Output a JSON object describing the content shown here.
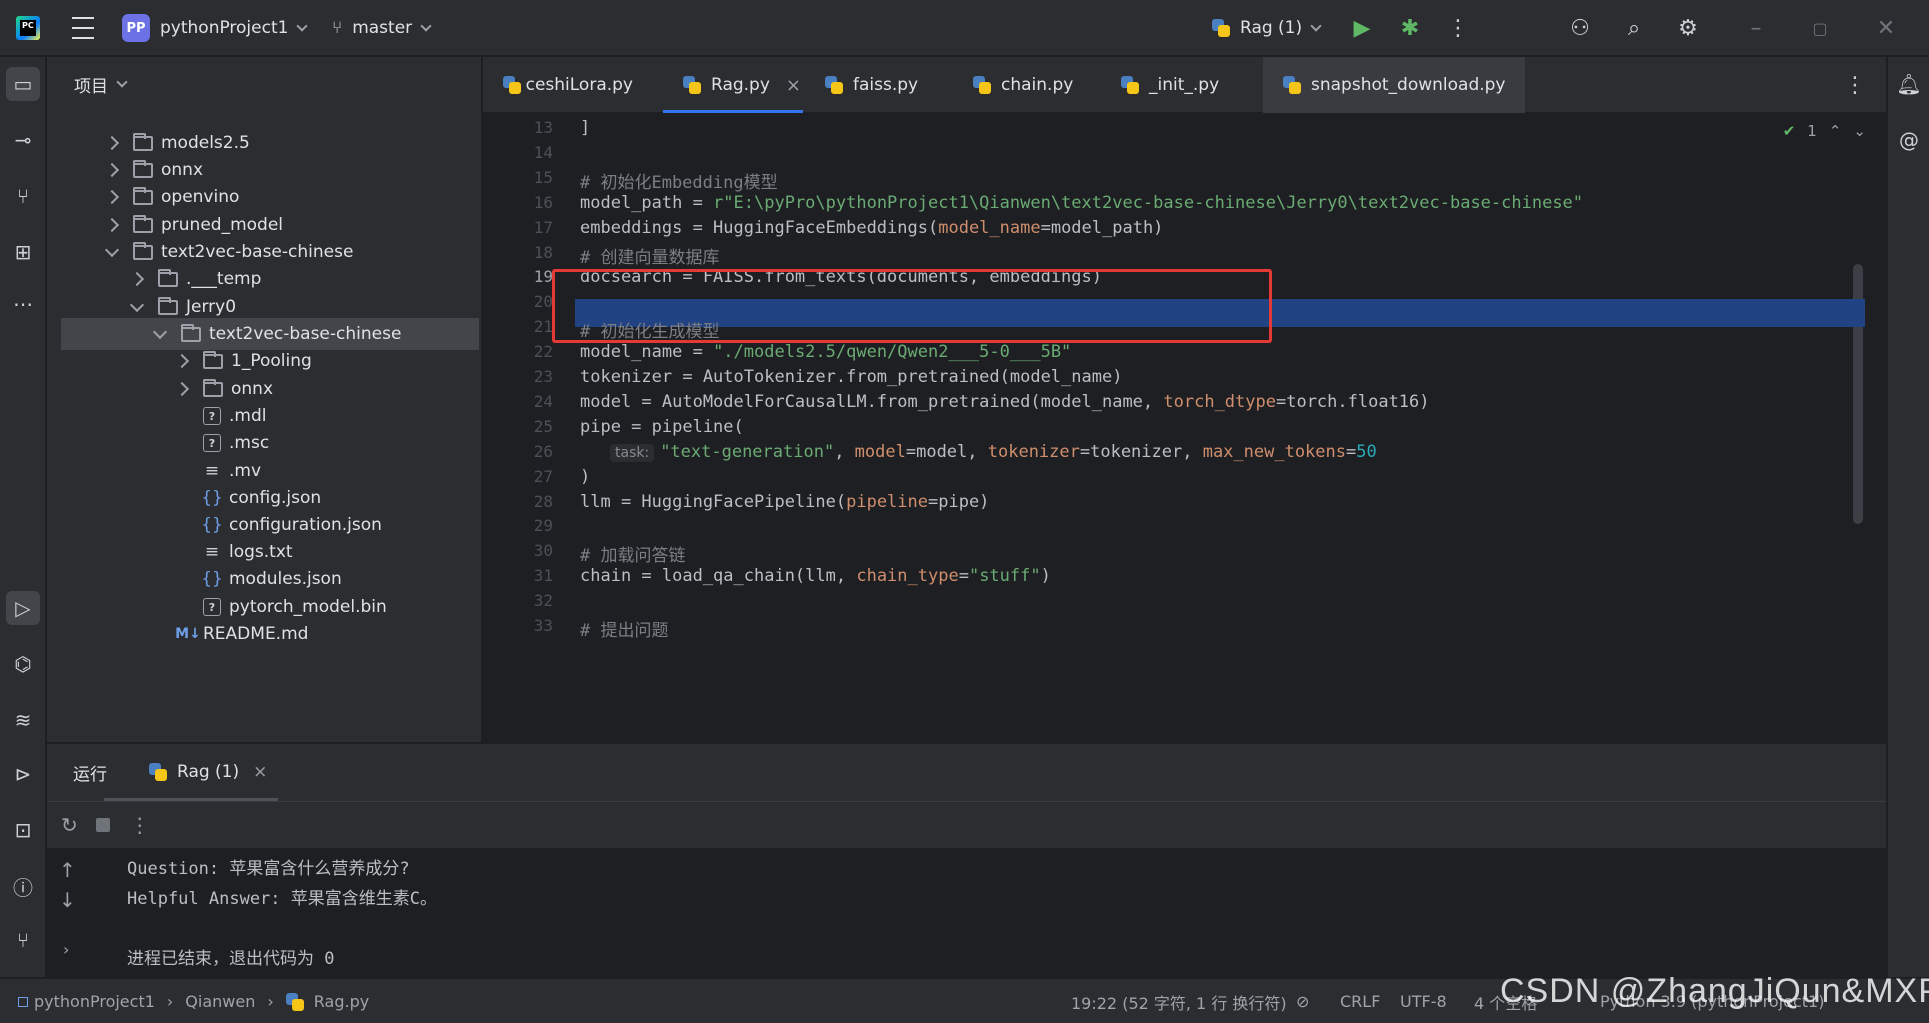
{
  "titlebar": {
    "project_badge": "PP",
    "project_name": "pythonProject1",
    "branch": "master",
    "run_config": "Rag (1)"
  },
  "project_panel": {
    "title": "项目",
    "tree": [
      {
        "label": "models2.5",
        "kind": "folder",
        "state": "collapsed"
      },
      {
        "label": "onnx",
        "kind": "folder",
        "state": "collapsed"
      },
      {
        "label": "openvino",
        "kind": "folder",
        "state": "collapsed"
      },
      {
        "label": "pruned_model",
        "kind": "folder",
        "state": "collapsed"
      },
      {
        "label": "text2vec-base-chinese",
        "kind": "folder",
        "state": "expanded"
      },
      {
        "label": ".___temp",
        "kind": "folder",
        "state": "collapsed"
      },
      {
        "label": "Jerry0",
        "kind": "folder",
        "state": "expanded"
      },
      {
        "label": "text2vec-base-chinese",
        "kind": "folder",
        "state": "expanded"
      },
      {
        "label": "1_Pooling",
        "kind": "folder",
        "state": "collapsed"
      },
      {
        "label": "onnx",
        "kind": "folder",
        "state": "collapsed"
      },
      {
        "label": ".mdl",
        "kind": "unknown"
      },
      {
        "label": ".msc",
        "kind": "unknown"
      },
      {
        "label": ".mv",
        "kind": "text"
      },
      {
        "label": "config.json",
        "kind": "json"
      },
      {
        "label": "configuration.json",
        "kind": "json"
      },
      {
        "label": "logs.txt",
        "kind": "text"
      },
      {
        "label": "modules.json",
        "kind": "json"
      },
      {
        "label": "pytorch_model.bin",
        "kind": "unknown"
      },
      {
        "label": "README.md",
        "kind": "markdown"
      }
    ]
  },
  "tabs": [
    {
      "label": "ceshiLora.py"
    },
    {
      "label": "Rag.py",
      "close": "×"
    },
    {
      "label": "faiss.py"
    },
    {
      "label": "chain.py"
    },
    {
      "label": "_init_.py"
    },
    {
      "label": "snapshot_download.py"
    }
  ],
  "editor": {
    "inspection_count": "1",
    "current_line": 19,
    "lines": [
      {
        "n": "13",
        "text": "]"
      },
      {
        "n": "14",
        "text": ""
      },
      {
        "n": "15",
        "text": "# 初始化Embedding模型"
      },
      {
        "n": "16",
        "text": "model_path = r\"E:\\pyPro\\pythonProject1\\Qianwen\\text2vec-base-chinese\\Jerry0\\text2vec-base-chinese\""
      },
      {
        "n": "17",
        "text": "embeddings = HuggingFaceEmbeddings(model_name=model_path)"
      },
      {
        "n": "18",
        "text": "# 创建向量数据库"
      },
      {
        "n": "19",
        "text": "docsearch = FAISS.from_texts(documents, embeddings)"
      },
      {
        "n": "20",
        "text": ""
      },
      {
        "n": "21",
        "text": "# 初始化生成模型"
      },
      {
        "n": "22",
        "text": "model_name = \"./models2.5/qwen/Qwen2___5-0___5B\""
      },
      {
        "n": "23",
        "text": "tokenizer = AutoTokenizer.from_pretrained(model_name)"
      },
      {
        "n": "24",
        "text": "model = AutoModelForCausalLM.from_pretrained(model_name, torch_dtype=torch.float16)"
      },
      {
        "n": "25",
        "text": "pipe = pipeline("
      },
      {
        "n": "26",
        "text": "\"text-generation\", model=model, tokenizer=tokenizer, max_new_tokens=50",
        "hint": "task:"
      },
      {
        "n": "27",
        "text": ")"
      },
      {
        "n": "28",
        "text": "llm = HuggingFacePipeline(pipeline=pipe)"
      },
      {
        "n": "29",
        "text": ""
      },
      {
        "n": "30",
        "text": "# 加载问答链"
      },
      {
        "n": "31",
        "text": "chain = load_qa_chain(llm, chain_type=\"stuff\")"
      },
      {
        "n": "32",
        "text": ""
      },
      {
        "n": "33",
        "text": "# 提出问题"
      }
    ]
  },
  "run_panel": {
    "title": "运行",
    "tab_label": "Rag (1)",
    "tab_close": "×",
    "console": [
      "Question: 苹果富含什么营养成分?",
      "Helpful Answer: 苹果富含维生素C。",
      "",
      "进程已结束，退出代码为 0"
    ]
  },
  "statusbar": {
    "breadcrumb": [
      "pythonProject1",
      "Qianwen",
      "Rag.py"
    ],
    "position": "19:22 (52 字符, 1 行 换行符)",
    "line_sep": "CRLF",
    "encoding": "UTF-8",
    "indent": "4 个空格",
    "interpreter": "Python 3.9 (pythonProject1)"
  },
  "watermark": "CSDN @ZhangJiQun&MXP",
  "colors": {
    "accent": "#3574f0",
    "highlight_line": "#214283",
    "annotation_box": "#e53935",
    "run_icon": "#5fb865",
    "debug_icon": "#5fb865"
  }
}
